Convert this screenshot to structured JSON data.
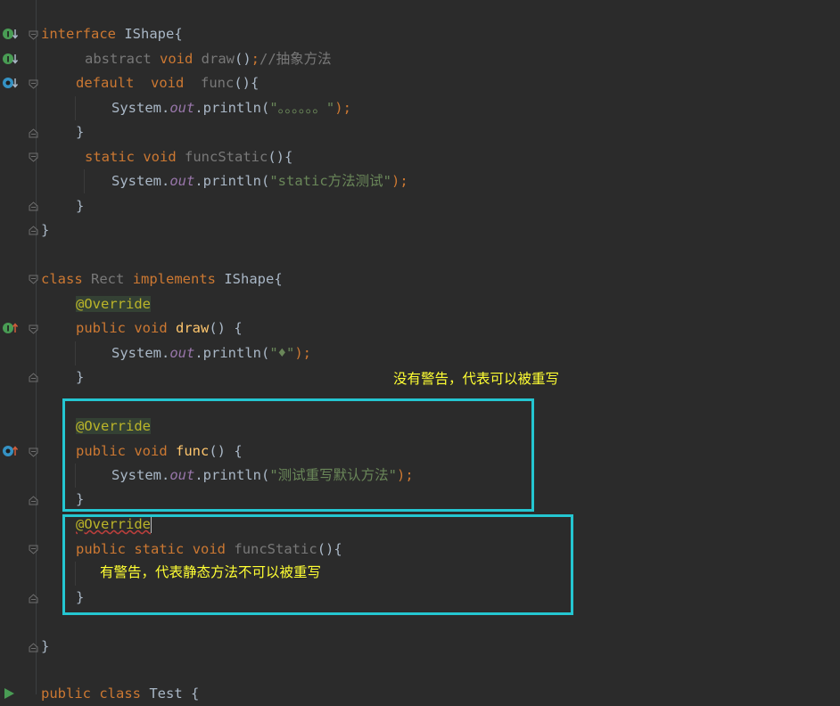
{
  "editor": {
    "lines": {
      "l1_kw": "interface",
      "l1_name": " IShape{",
      "l2_abstract": "abstract",
      "l2_void": "void",
      "l2_draw": "draw",
      "l2_paren": "()",
      "l2_semi": ";",
      "l2_comment": "//抽象方法",
      "l3_default": "default",
      "l3_void": "void",
      "l3_func": "func",
      "l3_rest": "(){",
      "l4_sys": "System.",
      "l4_out": "out",
      "l4_println": ".println(",
      "l4_str": "\"。。。。。。\"",
      "l4_end": ");",
      "l5_brace": "}",
      "l6_static": "static",
      "l6_void": "void",
      "l6_name": "funcStatic",
      "l6_rest": "(){",
      "l7_sys": "System.",
      "l7_out": "out",
      "l7_println": ".println(",
      "l7_str": "\"static方法测试\"",
      "l7_end": ");",
      "l8_brace": "}",
      "l9_brace": "}",
      "l11_class": "class",
      "l11_rect": "Rect",
      "l11_impl": "implements",
      "l11_ishape": " IShape{",
      "l12_anno": "@Override",
      "l13_public": "public",
      "l13_void": "void",
      "l13_draw": "draw",
      "l13_rest": "() {",
      "l14_sys": "System.",
      "l14_out": "out",
      "l14_println": ".println(",
      "l14_str": "\"♦\"",
      "l14_end": ");",
      "l15_brace": "}",
      "l17_anno": "@Override",
      "l18_public": "public",
      "l18_void": "void",
      "l18_func": "func",
      "l18_rest": "() {",
      "l19_sys": "System.",
      "l19_out": "out",
      "l19_println": ".println(",
      "l19_str": "\"测试重写默认方法\"",
      "l19_end": ");",
      "l20_brace": "}",
      "l21_anno": "@Override",
      "l22_public": "public",
      "l22_static": "static",
      "l22_void": "void",
      "l22_name": "funcStatic",
      "l22_rest": "(){",
      "l24_brace": "}",
      "l26_brace": "}",
      "l28_public": "public",
      "l28_class": "class",
      "l28_name": " Test {"
    },
    "annotations": {
      "note1": "没有警告，代表可以被重写",
      "note2": "有警告，代表静态方法不可以被重写"
    },
    "colors": {
      "background": "#2b2b2b",
      "highlight_box": "#24c6d1",
      "note_text": "#ffff33"
    }
  }
}
